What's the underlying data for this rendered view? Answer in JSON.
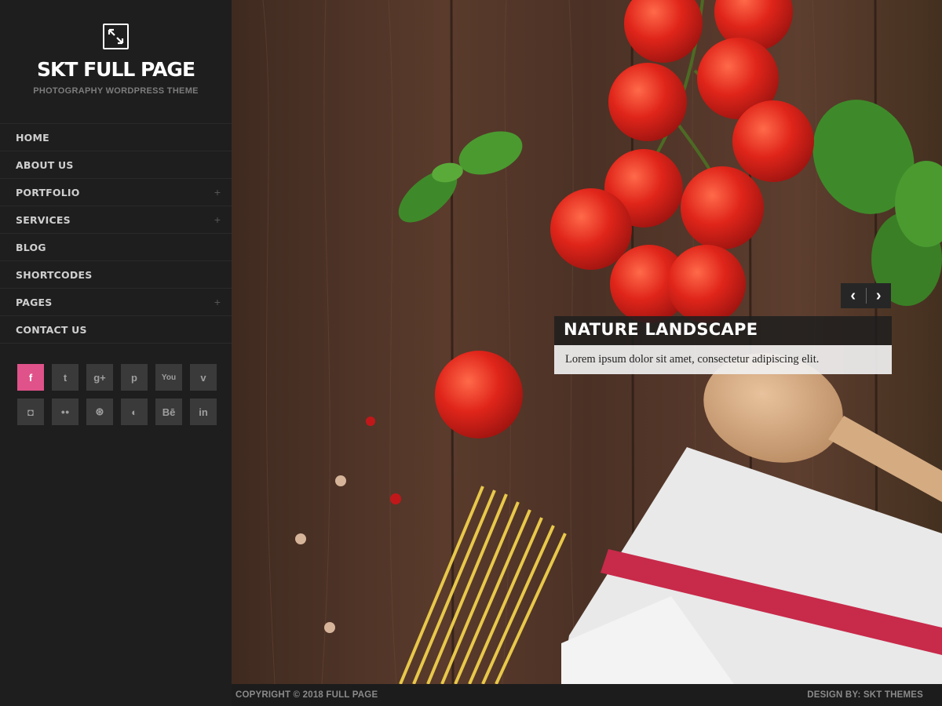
{
  "brand": {
    "title": "SKT FULL PAGE",
    "tagline": "PHOTOGRAPHY WORDPRESS THEME",
    "icon": "expand-icon"
  },
  "menu": [
    {
      "label": "HOME",
      "has_submenu": false
    },
    {
      "label": "ABOUT US",
      "has_submenu": false
    },
    {
      "label": "PORTFOLIO",
      "has_submenu": true
    },
    {
      "label": "SERVICES",
      "has_submenu": true
    },
    {
      "label": "BLOG",
      "has_submenu": false
    },
    {
      "label": "SHORTCODES",
      "has_submenu": false
    },
    {
      "label": "PAGES",
      "has_submenu": true
    },
    {
      "label": "CONTACT US",
      "has_submenu": false
    }
  ],
  "submenu_indicator": "+",
  "social": [
    {
      "name": "facebook-icon",
      "glyph": "f",
      "active": true
    },
    {
      "name": "twitter-icon",
      "glyph": "t",
      "active": false
    },
    {
      "name": "google-plus-icon",
      "glyph": "g+",
      "active": false
    },
    {
      "name": "pinterest-icon",
      "glyph": "p",
      "active": false
    },
    {
      "name": "youtube-icon",
      "glyph": "You",
      "active": false
    },
    {
      "name": "vimeo-icon",
      "glyph": "v",
      "active": false
    },
    {
      "name": "instagram-icon",
      "glyph": "◘",
      "active": false
    },
    {
      "name": "flickr-icon",
      "glyph": "●●",
      "active": false
    },
    {
      "name": "dribbble-icon",
      "glyph": "⊛",
      "active": false
    },
    {
      "name": "drop-icon",
      "glyph": "◐",
      "active": false
    },
    {
      "name": "behance-icon",
      "glyph": "Bē",
      "active": false
    },
    {
      "name": "linkedin-icon",
      "glyph": "in",
      "active": false
    }
  ],
  "slider": {
    "prev": "‹",
    "next": "›",
    "caption_title": "NATURE LANDSCAPE",
    "caption_text": "Lorem ipsum dolor sit amet, consectetur adipiscing elit."
  },
  "footer": {
    "copyright": "COPYRIGHT © 2018 FULL PAGE",
    "credit": "DESIGN BY: SKT THEMES"
  },
  "colors": {
    "accent": "#e0528a",
    "sidebar": "#1e1e1e",
    "wood": "#4a3226",
    "tomato": "#e0251a",
    "basil": "#3e8a2a"
  }
}
